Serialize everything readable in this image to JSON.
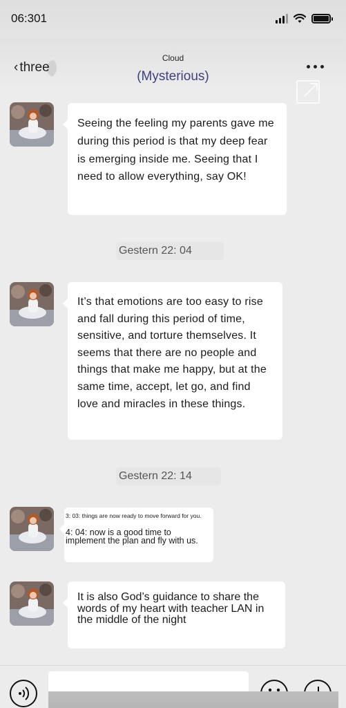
{
  "status": {
    "time": "06:301"
  },
  "nav": {
    "back_label": "three",
    "subtitle": "Cloud",
    "title": "(Mysterious)",
    "more_icon": "more-dots-icon",
    "share_icon": "share-external-icon"
  },
  "messages": [
    {
      "text": "Seeing the feeling my parents gave me during this period is that my deep fear is emerging inside me. Seeing that I need to allow everything, say OK!"
    },
    {
      "timestamp": "Gestern 22: 04"
    },
    {
      "text": "It’s that emotions are too easy to rise and fall during this period of time, sensitive, and torture themselves. It seems that there are no people and things that make me happy, but at the same time, accept, let go, and find love and miracles in these things."
    },
    {
      "timestamp": "Gestern 22: 14"
    },
    {
      "line1": "3: 03: things are now ready to move forward for you.",
      "line2": "4: 04: now is a good time to implement the plan and fly with us."
    },
    {
      "text": "It is also God’s guidance to share the words of my heart with teacher LAN in the middle of the night"
    }
  ],
  "input_bar": {
    "voice_icon": "voice-icon",
    "emoji_icon": "emoji-icon",
    "plus_icon": "plus-icon"
  }
}
